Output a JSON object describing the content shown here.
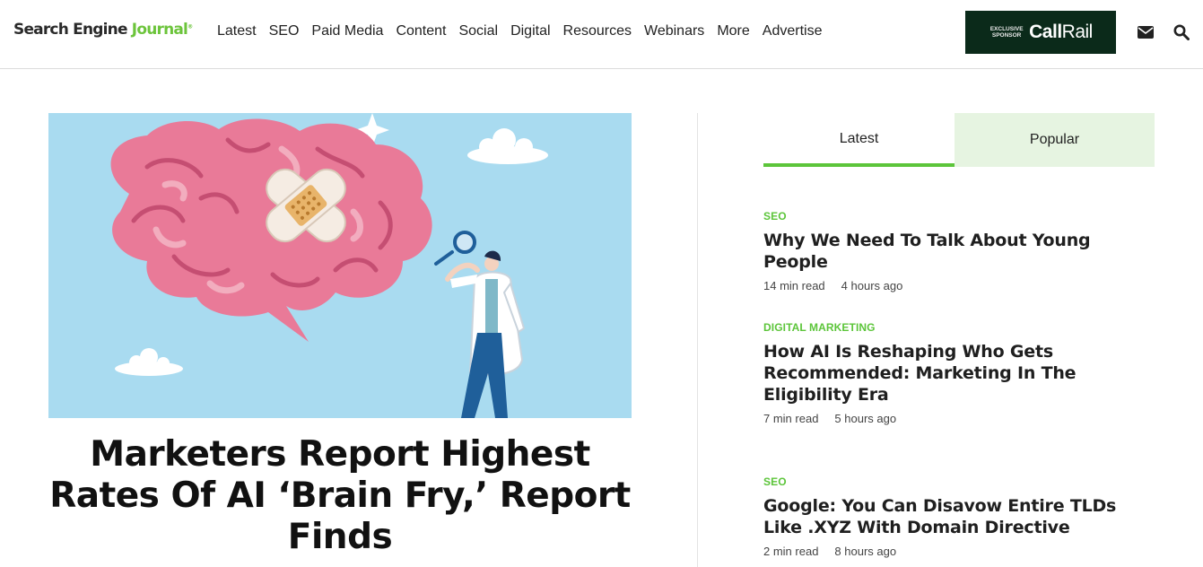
{
  "header": {
    "logo": {
      "part1": "Search Engine ",
      "part2": "Journal",
      "tm": "®"
    },
    "nav": [
      "Latest",
      "SEO",
      "Paid Media",
      "Content",
      "Social",
      "Digital",
      "Resources",
      "Webinars",
      "More",
      "Advertise"
    ],
    "sponsor": {
      "tag_line1": "EXCLUSIVE",
      "tag_line2": "SPONSOR",
      "brand_a": "Call",
      "brand_b": "Rail"
    },
    "icons": [
      "envelope-icon",
      "search-icon"
    ]
  },
  "hero": {
    "headline": "Marketers Report Highest Rates Of AI ‘Brain Fry,’ Report Finds"
  },
  "sidebar": {
    "tabs": [
      "Latest",
      "Popular"
    ],
    "articles": [
      {
        "category": "SEO",
        "title": "Why We Need To Talk About Young People",
        "read": "14 min read",
        "time": "4 hours ago"
      },
      {
        "category": "DIGITAL MARKETING",
        "title": "How AI Is Reshaping Who Gets Recommended: Marketing In The Eligibility Era",
        "read": "7 min read",
        "time": "5 hours ago"
      },
      {
        "category": "SEO",
        "title": "Google: You Can Disavow Entire TLDs Like .XYZ With Domain Directive",
        "read": "2 min read",
        "time": "8 hours ago"
      }
    ]
  },
  "colors": {
    "accent": "#5cc53a",
    "tab_bg": "#e6f4e1",
    "sponsor_bg": "#0b2a1a",
    "hero_sky": "#a9dbf0",
    "brain_pink": "#e97a98"
  }
}
